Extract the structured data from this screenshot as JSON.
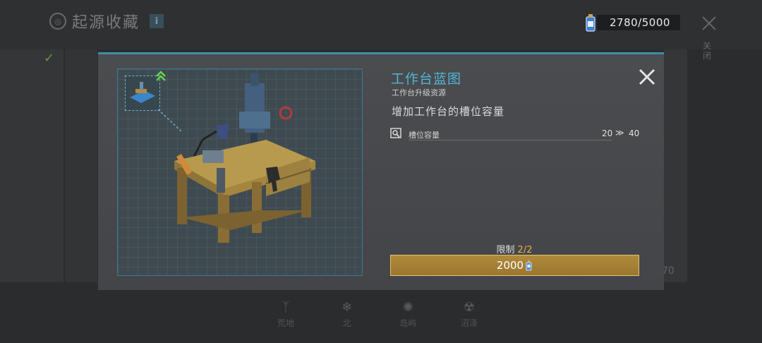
{
  "background": {
    "title": "起源收藏",
    "title_badge_icon": "circle-badge-icon",
    "info_label": "i",
    "currency": {
      "value": "2780/5000",
      "icon": "fuel-can-icon"
    },
    "close_label": "关闭",
    "side_number": "70",
    "bottom_nav": [
      {
        "label": "荒地",
        "icon": "grass-icon"
      },
      {
        "label": "北",
        "icon": "snowflake-icon"
      },
      {
        "label": "岛屿",
        "icon": "virus-icon"
      },
      {
        "label": "沼泽",
        "icon": "radiation-icon"
      }
    ]
  },
  "modal": {
    "title": "工作台蓝图",
    "subtitle": "工作台升级资源",
    "description": "增加工作台的槽位容量",
    "stat": {
      "label": "槽位容量",
      "from": "20",
      "arrow": "≫",
      "to": "40"
    },
    "limit_label": "限制",
    "limit_value": "2/2",
    "price": "2000",
    "colors": {
      "title": "#52b5d6",
      "button": "#a5802f",
      "limit": "#e3b34a"
    }
  }
}
